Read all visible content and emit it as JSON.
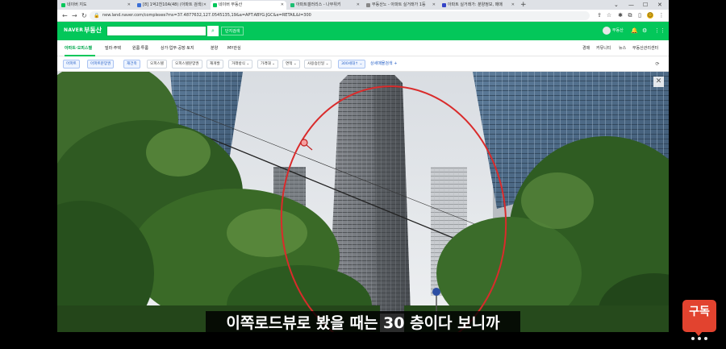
{
  "tabs": [
    {
      "label": "네이버 지도",
      "favicon_color": "#03c75a",
      "active": false
    },
    {
      "label": "[8] 1억2천10A(48) (아파트 검색)",
      "favicon_color": "#3b6fd6",
      "active": false
    },
    {
      "label": "네이버 부동산",
      "favicon_color": "#03c75a",
      "active": true
    },
    {
      "label": "아파트갤러리스 - 나무위키",
      "favicon_color": "#1dbf73",
      "active": false
    },
    {
      "label": "부동산노 - 아파트 실거래가 1등",
      "favicon_color": "#888888",
      "active": false
    },
    {
      "label": "아파트 실거래가: 분양정보, 매매",
      "favicon_color": "#3443c7",
      "active": false
    }
  ],
  "address": {
    "url": "new.land.naver.com/complexes?ms=37.4877632,127.0545135,19&a=APT:ABYG:JGC&e=RETAIL&l=300"
  },
  "header": {
    "logo": "NAVER",
    "service": "부동산",
    "search_placeholder": "",
    "complex_search_label": "단지검색",
    "user_label": "부동산"
  },
  "categories": [
    {
      "label": "아파트·오피스텔",
      "active": true
    },
    {
      "label": "빌라·주택",
      "active": false
    },
    {
      "label": "원룸·투룸",
      "active": false
    },
    {
      "label": "상가·업무·공장·토지",
      "active": false
    },
    {
      "label": "분양",
      "active": false
    },
    {
      "label": "MY관심",
      "active": false
    }
  ],
  "right_links": [
    "경매",
    "커뮤니티",
    "뉴스",
    "부동산관리센터"
  ],
  "filters": [
    {
      "label": "아파트",
      "style": "blue"
    },
    {
      "label": "아파트분양권",
      "style": "blue"
    },
    {
      "label": "재건축",
      "style": "blue"
    },
    {
      "label": "오피스텔",
      "style": "plain"
    },
    {
      "label": "오피스텔분양권",
      "style": "plain"
    },
    {
      "label": "재개발",
      "style": "plain"
    },
    {
      "label": "거래방식 ⌄",
      "style": "plain"
    },
    {
      "label": "가격대 ⌄",
      "style": "plain"
    },
    {
      "label": "면적 ⌄",
      "style": "plain"
    },
    {
      "label": "사용승인일 ⌄",
      "style": "plain"
    },
    {
      "label": "300세대↑ ⌄",
      "style": "blue"
    }
  ],
  "detail_search_label": "상세매물검색 +",
  "subtitle": "이쪽로드뷰로 봤을 때는 30 층이다 보니까",
  "badge": {
    "label": "구독"
  },
  "colors": {
    "naver_green": "#03c75a",
    "annotation_red": "#d92b2b",
    "badge_red": "#e2432f"
  }
}
